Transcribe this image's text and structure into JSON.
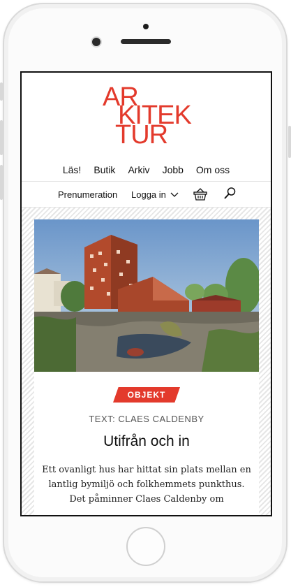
{
  "logo": {
    "line1": "AR",
    "line2": "KITEK",
    "line3": "TUR",
    "color": "#e33a2c"
  },
  "nav": {
    "primary": [
      "Läs!",
      "Butik",
      "Arkiv",
      "Jobb",
      "Om oss"
    ],
    "subscribe": "Prenumeration",
    "login": "Logga in",
    "icons": [
      "chevron-down-icon",
      "basket-icon",
      "search-icon"
    ]
  },
  "article": {
    "category": "OBJEKT",
    "byline": "TEXT: CLAES CALDENBY",
    "title": "Utifrån och in",
    "lead": "Ett ovanligt hus har hittat sin plats mellan en lantlig bymiljö och folkhemmets punkthus. Det påminner Claes Caldenby om"
  },
  "colors": {
    "accent": "#e33a2c",
    "text": "#111111"
  }
}
